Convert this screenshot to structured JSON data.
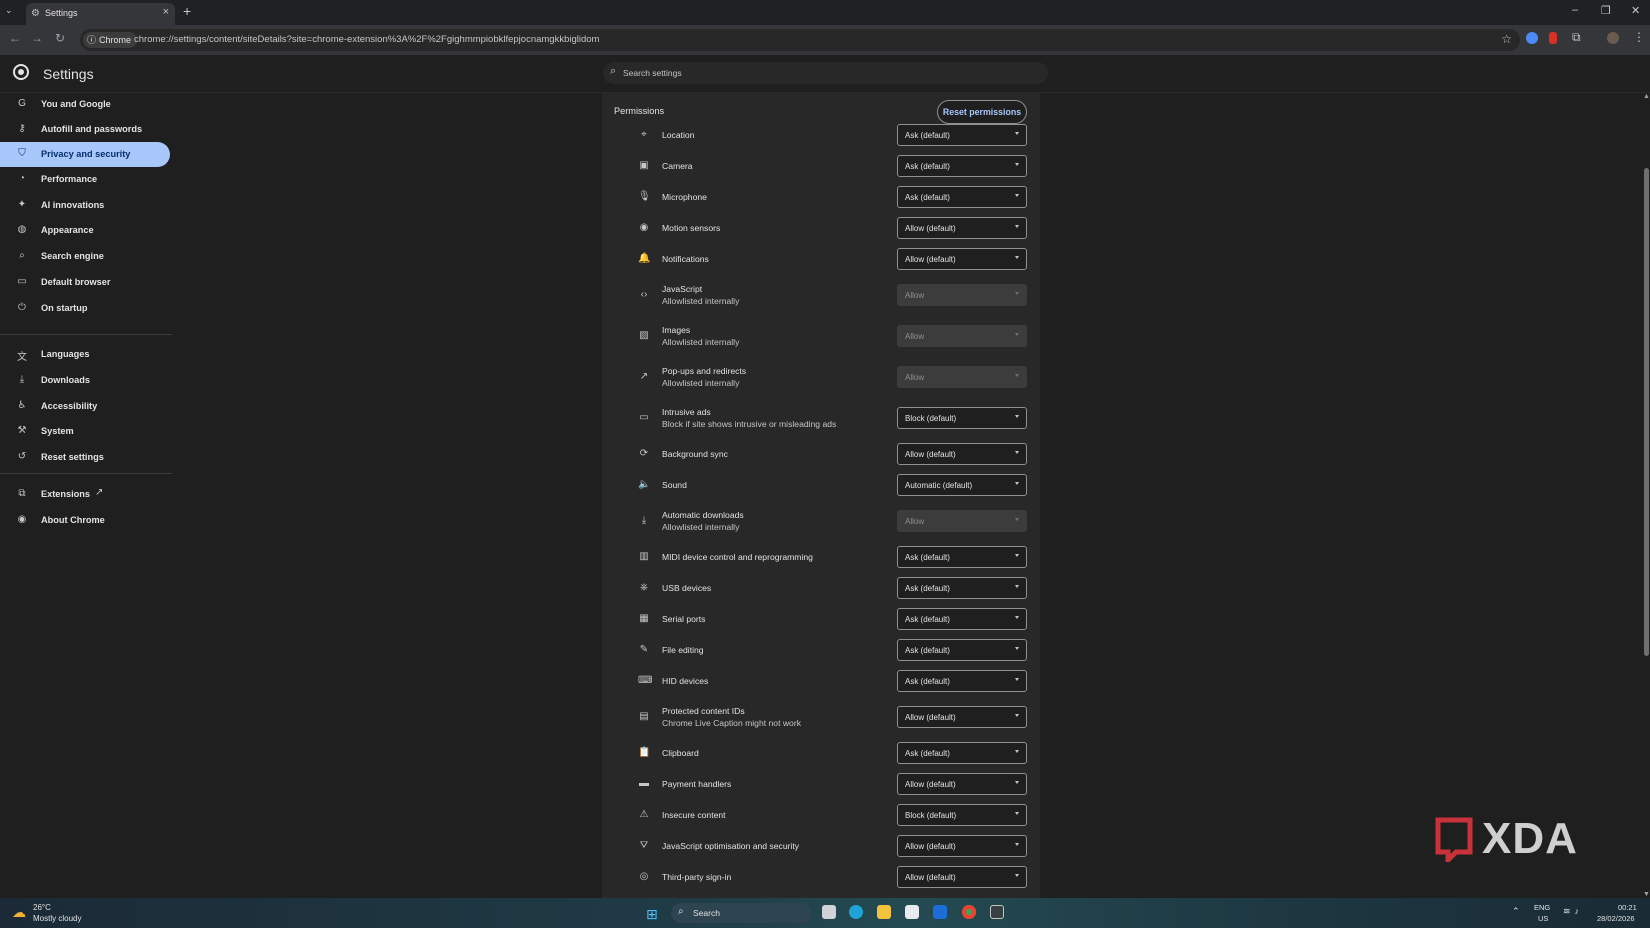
{
  "browser": {
    "tab_title": "Settings",
    "site_chip": "Chrome",
    "url": "chrome://settings/content/siteDetails?site=chrome-extension%3A%2F%2Fgighmmpiobklfepjocnamgkkbiglidom"
  },
  "header": {
    "title": "Settings",
    "search_placeholder": "Search settings"
  },
  "sidebar": {
    "items": [
      {
        "label": "You and Google",
        "icon": "google-g-icon"
      },
      {
        "label": "Autofill and passwords",
        "icon": "key-icon"
      },
      {
        "label": "Privacy and security",
        "icon": "shield-icon",
        "active": true
      },
      {
        "label": "Performance",
        "icon": "speedometer-icon"
      },
      {
        "label": "AI innovations",
        "icon": "sparkle-icon"
      },
      {
        "label": "Appearance",
        "icon": "palette-icon"
      },
      {
        "label": "Search engine",
        "icon": "search-icon"
      },
      {
        "label": "Default browser",
        "icon": "browser-window-icon"
      },
      {
        "label": "On startup",
        "icon": "power-icon"
      },
      {
        "label": "Languages",
        "icon": "translate-icon"
      },
      {
        "label": "Downloads",
        "icon": "download-icon"
      },
      {
        "label": "Accessibility",
        "icon": "accessibility-icon"
      },
      {
        "label": "System",
        "icon": "wrench-icon"
      },
      {
        "label": "Reset settings",
        "icon": "reset-icon"
      },
      {
        "label": "Extensions",
        "icon": "puzzle-icon"
      },
      {
        "label": "About Chrome",
        "icon": "chrome-icon"
      }
    ]
  },
  "permissions": {
    "heading": "Permissions",
    "reset_label": "Reset permissions",
    "rows": [
      {
        "name": "Location",
        "sub": "",
        "value": "Ask (default)",
        "disabled": false,
        "icon": "location-pin-icon"
      },
      {
        "name": "Camera",
        "sub": "",
        "value": "Ask (default)",
        "disabled": false,
        "icon": "camera-icon"
      },
      {
        "name": "Microphone",
        "sub": "",
        "value": "Ask (default)",
        "disabled": false,
        "icon": "microphone-icon"
      },
      {
        "name": "Motion sensors",
        "sub": "",
        "value": "Allow (default)",
        "disabled": false,
        "icon": "sensors-icon"
      },
      {
        "name": "Notifications",
        "sub": "",
        "value": "Allow (default)",
        "disabled": false,
        "icon": "bell-icon"
      },
      {
        "name": "JavaScript",
        "sub": "Allowlisted internally",
        "value": "Allow",
        "disabled": true,
        "icon": "code-icon"
      },
      {
        "name": "Images",
        "sub": "Allowlisted internally",
        "value": "Allow",
        "disabled": true,
        "icon": "image-icon"
      },
      {
        "name": "Pop-ups and redirects",
        "sub": "Allowlisted internally",
        "value": "Allow",
        "disabled": true,
        "icon": "external-link-icon"
      },
      {
        "name": "Intrusive ads",
        "sub": "Block if site shows intrusive or misleading ads",
        "value": "Block (default)",
        "disabled": false,
        "icon": "ad-window-icon"
      },
      {
        "name": "Background sync",
        "sub": "",
        "value": "Allow (default)",
        "disabled": false,
        "icon": "sync-icon"
      },
      {
        "name": "Sound",
        "sub": "",
        "value": "Automatic (default)",
        "disabled": false,
        "icon": "speaker-icon"
      },
      {
        "name": "Automatic downloads",
        "sub": "Allowlisted internally",
        "value": "Allow",
        "disabled": true,
        "icon": "download-icon"
      },
      {
        "name": "MIDI device control and reprogramming",
        "sub": "",
        "value": "Ask (default)",
        "disabled": false,
        "icon": "piano-icon"
      },
      {
        "name": "USB devices",
        "sub": "",
        "value": "Ask (default)",
        "disabled": false,
        "icon": "usb-icon"
      },
      {
        "name": "Serial ports",
        "sub": "",
        "value": "Ask (default)",
        "disabled": false,
        "icon": "serial-port-icon"
      },
      {
        "name": "File editing",
        "sub": "",
        "value": "Ask (default)",
        "disabled": false,
        "icon": "file-edit-icon"
      },
      {
        "name": "HID devices",
        "sub": "",
        "value": "Ask (default)",
        "disabled": false,
        "icon": "keyboard-icon"
      },
      {
        "name": "Protected content IDs",
        "sub": "Chrome Live Caption might not work",
        "value": "Allow (default)",
        "disabled": false,
        "icon": "protected-content-icon"
      },
      {
        "name": "Clipboard",
        "sub": "",
        "value": "Ask (default)",
        "disabled": false,
        "icon": "clipboard-icon"
      },
      {
        "name": "Payment handlers",
        "sub": "",
        "value": "Allow (default)",
        "disabled": false,
        "icon": "credit-card-icon"
      },
      {
        "name": "Insecure content",
        "sub": "",
        "value": "Block (default)",
        "disabled": false,
        "icon": "warning-icon"
      },
      {
        "name": "JavaScript optimisation and security",
        "sub": "",
        "value": "Allow (default)",
        "disabled": false,
        "icon": "js-optimise-icon"
      },
      {
        "name": "Third-party sign-in",
        "sub": "",
        "value": "Allow (default)",
        "disabled": false,
        "icon": "account-icon"
      }
    ]
  },
  "watermark": {
    "text": "XDA"
  },
  "taskbar": {
    "weather_temp": "26°C",
    "weather_condition": "Mostly cloudy",
    "search_label": "Search",
    "lang_line1": "ENG",
    "lang_line2": "US",
    "time": "00:21",
    "date": "28/02/2026"
  },
  "colors": {
    "accent": "#a8c7fa",
    "background": "#1f1f1f",
    "panel": "#282828"
  }
}
